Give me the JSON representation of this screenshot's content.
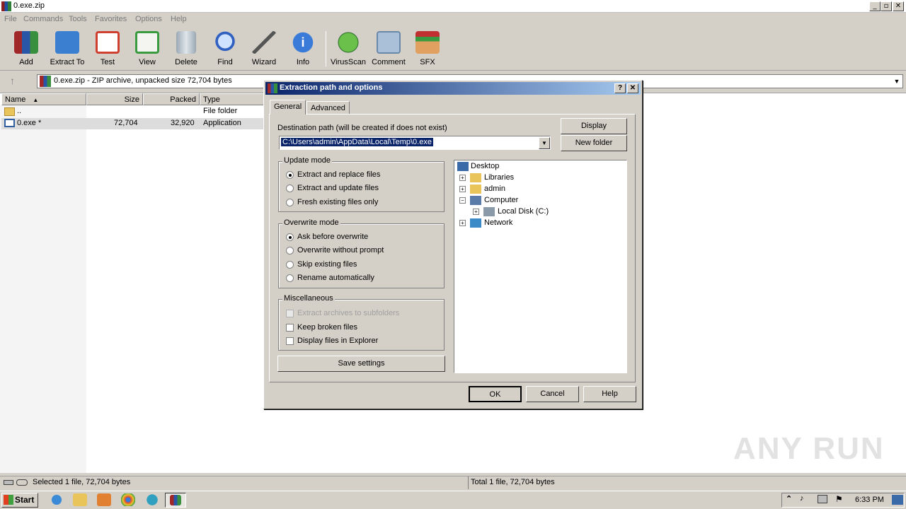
{
  "window": {
    "title": "0.exe.zip",
    "controls": [
      "_",
      "▫",
      "✕"
    ]
  },
  "menu": [
    "File",
    "Commands",
    "Tools",
    "Favorites",
    "Options",
    "Help"
  ],
  "toolbar": [
    {
      "label": "Add",
      "icon": "add-archive-icon",
      "color": "#c0392b"
    },
    {
      "label": "Extract To",
      "icon": "extract-folder-icon",
      "color": "#3a7fd0"
    },
    {
      "label": "Test",
      "icon": "test-clipboard-icon",
      "color": "#d04030"
    },
    {
      "label": "View",
      "icon": "view-book-icon",
      "color": "#3a9a40"
    },
    {
      "label": "Delete",
      "icon": "trash-icon",
      "color": "#8a9aa8"
    },
    {
      "label": "Find",
      "icon": "magnifier-icon",
      "color": "#3060c0"
    },
    {
      "label": "Wizard",
      "icon": "wand-icon",
      "color": "#9a8040"
    },
    {
      "label": "Info",
      "icon": "info-icon",
      "color": "#3070d0"
    },
    {
      "label": "VirusScan",
      "icon": "virus-scan-icon",
      "color": "#40a040"
    },
    {
      "label": "Comment",
      "icon": "comment-icon",
      "color": "#7090b0"
    },
    {
      "label": "SFX",
      "icon": "sfx-box-icon",
      "color": "#d08040"
    }
  ],
  "address": {
    "text": "0.exe.zip - ZIP archive, unpacked size 72,704 bytes"
  },
  "filelist": {
    "columns": [
      "Name",
      "Size",
      "Packed",
      "Type"
    ],
    "rows": [
      {
        "name": "..",
        "size": "",
        "packed": "",
        "type": "File folder"
      },
      {
        "name": "0.exe *",
        "size": "72,704",
        "packed": "32,920",
        "type": "Application"
      }
    ]
  },
  "status": {
    "left": "Selected 1 file, 72,704 bytes",
    "right": "Total 1 file, 72,704 bytes"
  },
  "dialog": {
    "title": "Extraction path and options",
    "help_btn": "?",
    "close_btn": "✕",
    "tabs": [
      "General",
      "Advanced"
    ],
    "dest_label": "Destination path (will be created if does not exist)",
    "dest_value": "C:\\Users\\admin\\AppData\\Local\\Temp\\0.exe",
    "display_btn": "Display",
    "newfolder_btn": "New folder",
    "update_mode": {
      "label": "Update mode",
      "options": [
        "Extract and replace files",
        "Extract and update files",
        "Fresh existing files only"
      ],
      "selected": 0
    },
    "overwrite_mode": {
      "label": "Overwrite mode",
      "options": [
        "Ask before overwrite",
        "Overwrite without prompt",
        "Skip existing files",
        "Rename automatically"
      ],
      "selected": 0
    },
    "misc": {
      "label": "Miscellaneous",
      "options": [
        "Extract archives to subfolders",
        "Keep broken files",
        "Display files in Explorer"
      ]
    },
    "save_btn": "Save settings",
    "tree": [
      {
        "label": "Desktop",
        "exp": ""
      },
      {
        "label": "Libraries",
        "exp": "+"
      },
      {
        "label": "admin",
        "exp": "+"
      },
      {
        "label": "Computer",
        "exp": "−"
      },
      {
        "label": "Local Disk (C:)",
        "exp": "+"
      },
      {
        "label": "Network",
        "exp": "+"
      }
    ],
    "ok_btn": "OK",
    "cancel_btn": "Cancel",
    "help_button": "Help"
  },
  "taskbar": {
    "start": "Start",
    "time": "6:33 PM"
  },
  "watermark": "ANY RUN"
}
